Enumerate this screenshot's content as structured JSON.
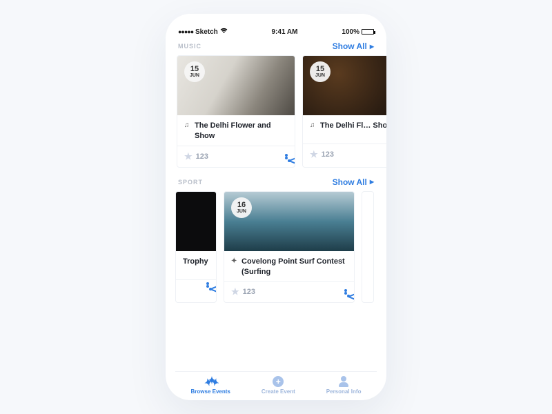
{
  "statusbar": {
    "carrier": "Sketch",
    "time": "9:41 AM",
    "battery": "100%"
  },
  "sections": {
    "music": {
      "label": "MUSIC",
      "show_all": "Show All",
      "cards": [
        {
          "day": "15",
          "month": "JUN",
          "title": "The Delhi Flower and Show",
          "stars": "123"
        },
        {
          "day": "15",
          "month": "JUN",
          "title": "The Delhi Fl…  Show",
          "stars": "123"
        }
      ]
    },
    "sport": {
      "label": "SPORT",
      "show_all": "Show All",
      "left_title": "Trophy",
      "card": {
        "day": "16",
        "month": "JUN",
        "title": "Covelong Point Surf Contest (Surfing",
        "stars": "123"
      }
    }
  },
  "tabs": {
    "browse": "Browse Events",
    "create": "Create Event",
    "personal": "Personal Info"
  }
}
